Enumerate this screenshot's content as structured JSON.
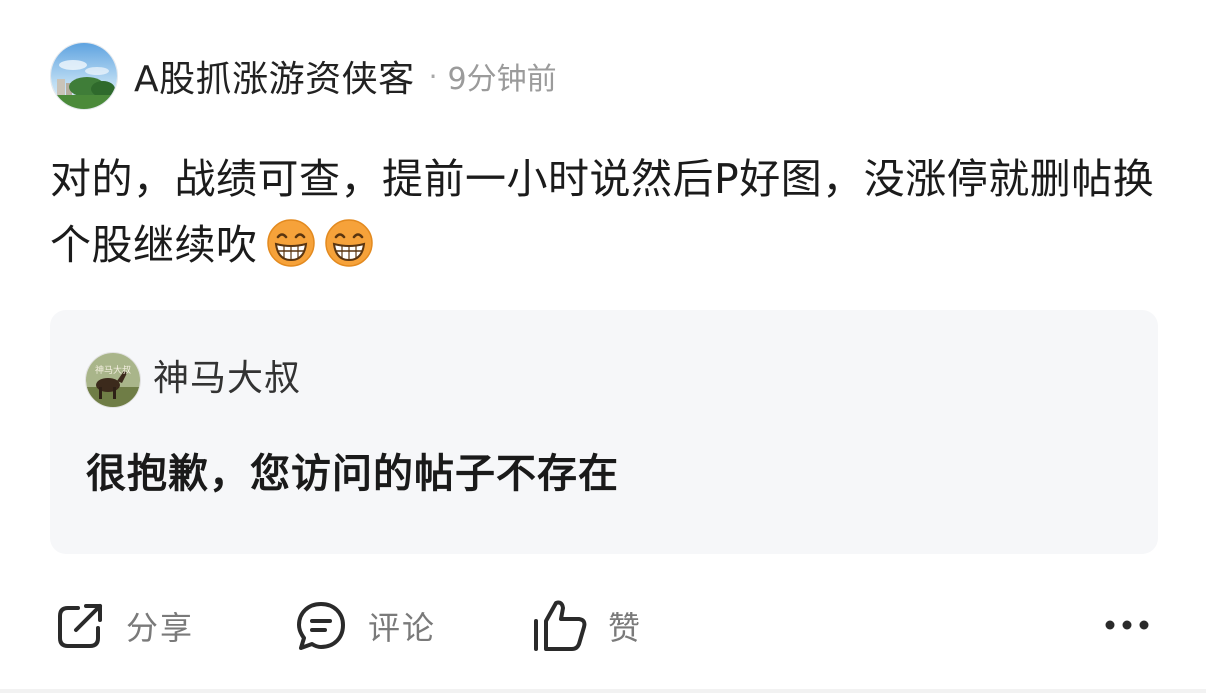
{
  "post": {
    "author": "A股抓涨游资侠客",
    "separator": "·",
    "time": "9分钟前",
    "content": "对的，战绩可查，提前一小时说然后P好图，没涨停就删帖换个股继续吹",
    "emojis": [
      "grinning-face-icon",
      "grinning-face-icon"
    ]
  },
  "quote": {
    "author": "神马大叔",
    "avatar_text": "神马大叔",
    "message": "很抱歉，您访问的帖子不存在"
  },
  "actions": {
    "share_label": "分享",
    "comment_label": "评论",
    "like_label": "赞"
  },
  "colors": {
    "card_bg": "#f6f7f9",
    "emoji_face": "#f6a23a",
    "secondary_text": "#9b9b9b"
  }
}
